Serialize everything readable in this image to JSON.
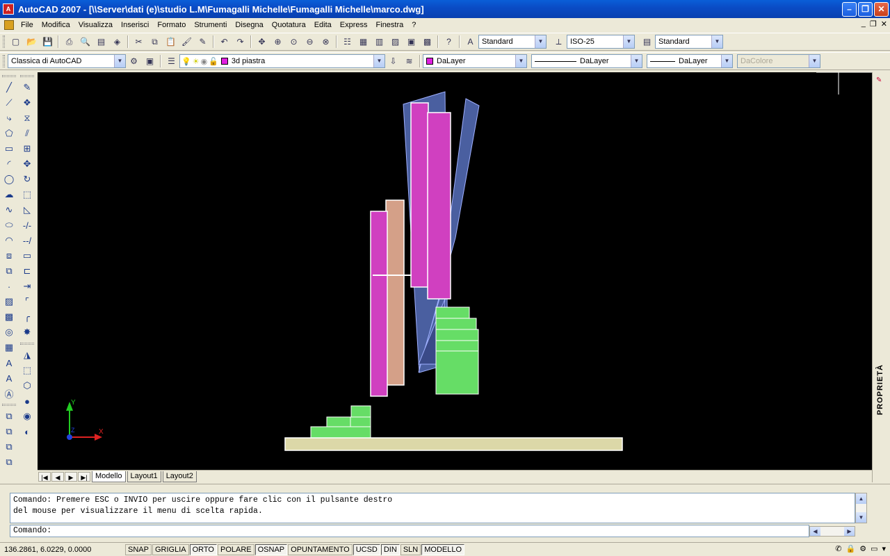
{
  "window": {
    "title": "AutoCAD 2007 - [\\\\Server\\dati (e)\\studio L.M\\Fumagalli Michelle\\Fumagalli Michelle\\marco.dwg]",
    "app_icon_text": "A"
  },
  "menu": {
    "items": [
      "File",
      "Modifica",
      "Visualizza",
      "Inserisci",
      "Formato",
      "Strumenti",
      "Disegna",
      "Quotatura",
      "Edita",
      "Express",
      "Finestra",
      "?"
    ]
  },
  "toolbar1": {
    "text_style": "Standard",
    "dim_style": "ISO-25",
    "table_style": "Standard"
  },
  "toolbar2": {
    "workspace": "Classica di AutoCAD",
    "layer": "3d piastra",
    "color": "DaLayer",
    "linetype": "DaLayer",
    "lineweight": "DaLayer",
    "plotstyle": "DaColore"
  },
  "colors": {
    "magenta": "#d040c0",
    "salmon": "#d4a088",
    "blue_panel": "#4a5fa0",
    "green": "#66dd66",
    "base": "#dcd8a8"
  },
  "ucs": {
    "x_label": "X",
    "y_label": "Y",
    "z_label": "Z"
  },
  "layout_tabs": [
    "Modello",
    "Layout1",
    "Layout2"
  ],
  "properties_panel": {
    "label": "PROPRIETÀ"
  },
  "command": {
    "history_line1": "Comando: Premere ESC o INVIO per uscire oppure fare clic con il pulsante destro",
    "history_line2": "del mouse per visualizzare il menu di scelta rapida.",
    "prompt": "Comando:"
  },
  "status": {
    "coords": "136.2861, 6.0229, 0.0000",
    "buttons": [
      "SNAP",
      "GRIGLIA",
      "ORTO",
      "POLARE",
      "OSNAP",
      "OPUNTAMENTO",
      "UCSD",
      "DIN",
      "SLN",
      "MODELLO"
    ]
  }
}
